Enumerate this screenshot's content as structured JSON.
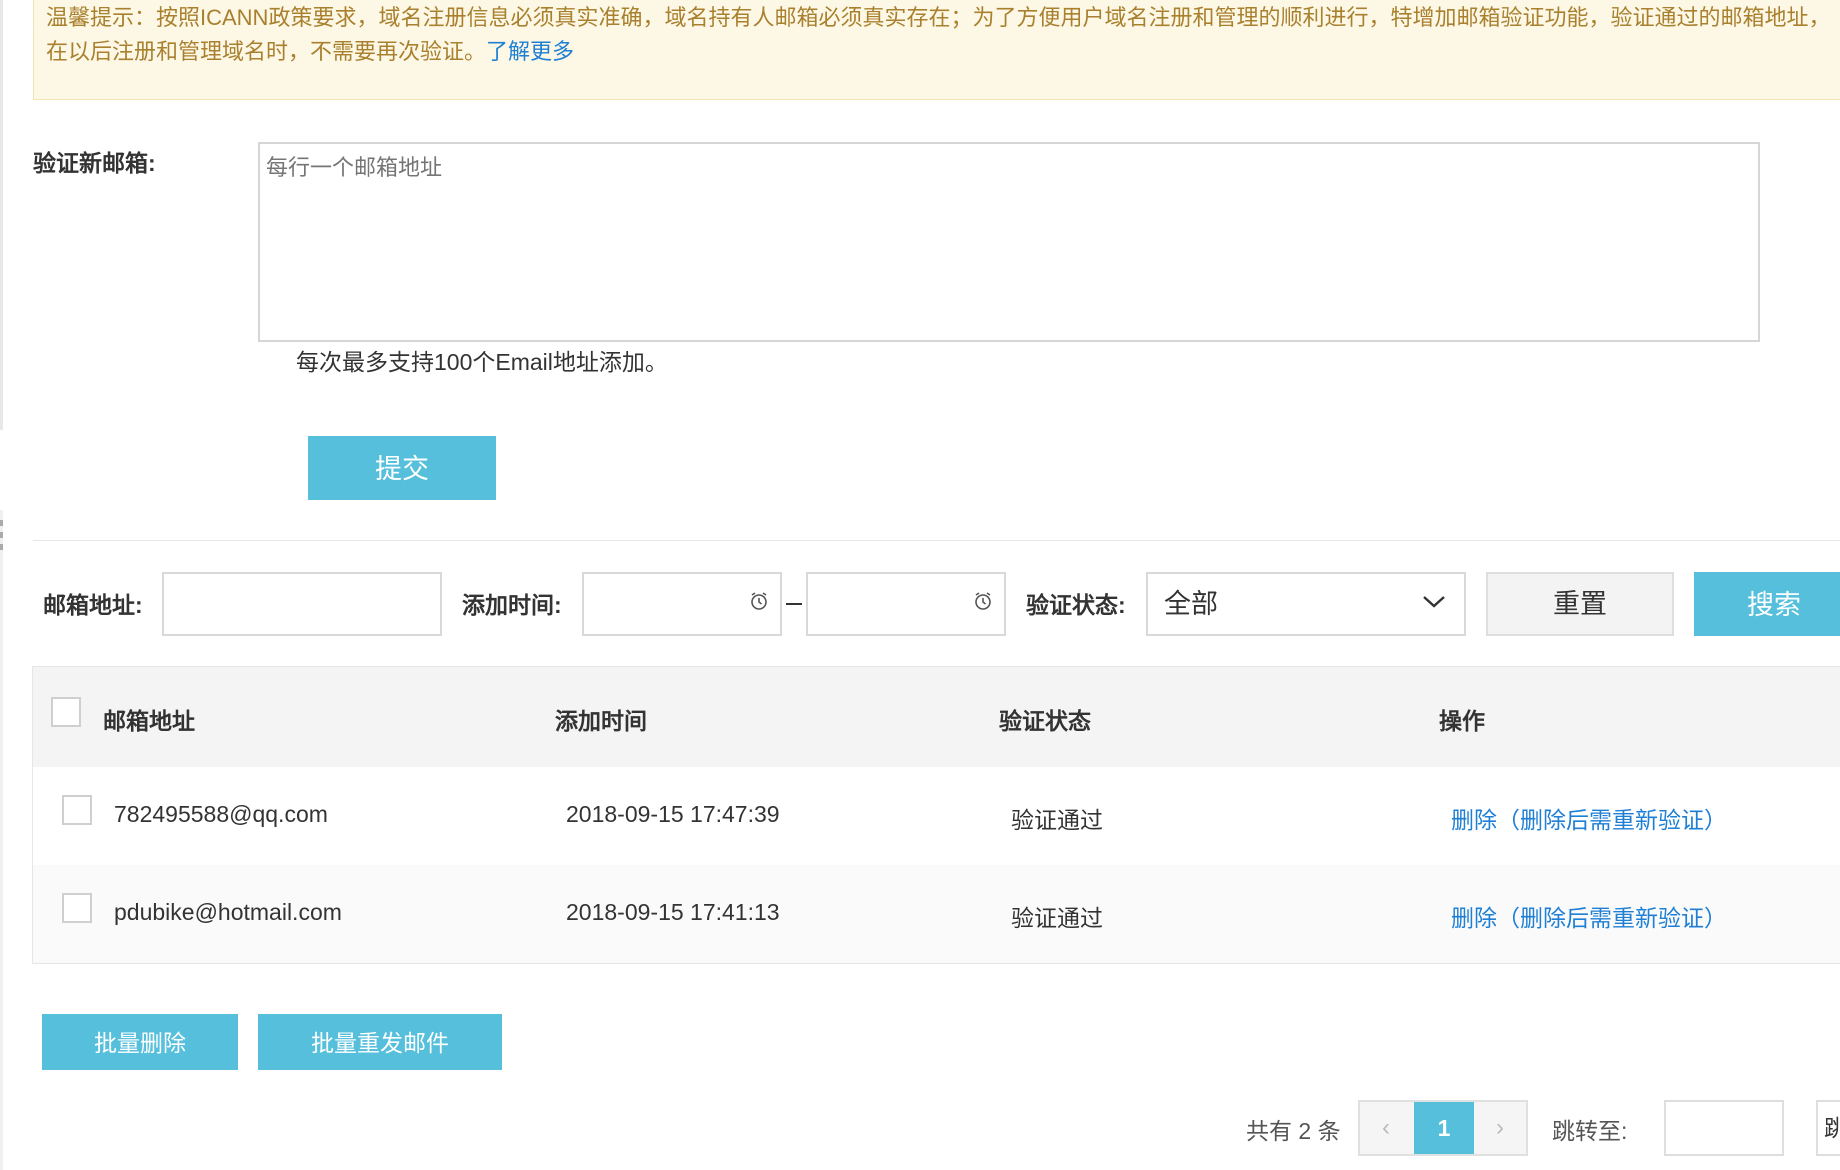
{
  "notice": {
    "text": "温馨提示：按照ICANN政策要求，域名注册信息必须真实准确，域名持有人邮箱必须真实存在；为了方便用户域名注册和管理的顺利进行，特增加邮箱验证功能，验证通过的邮箱地址，在以后注册和管理域名时，不需要再次验证。",
    "link": "了解更多"
  },
  "verify_form": {
    "label": "验证新邮箱:",
    "placeholder": "每行一个邮箱地址",
    "hint": "每次最多支持100个Email地址添加。",
    "submit_label": "提交"
  },
  "filters": {
    "email_label": "邮箱地址:",
    "email_value": "",
    "time_label": "添加时间:",
    "time_separator": "—",
    "status_label": "验证状态:",
    "status_value": "全部",
    "reset_label": "重置",
    "search_label": "搜索"
  },
  "table": {
    "headers": [
      "邮箱地址",
      "添加时间",
      "验证状态",
      "操作"
    ],
    "rows": [
      {
        "email": "782495588@qq.com",
        "time": "2018-09-15 17:47:39",
        "status": "验证通过",
        "action": "删除（删除后需重新验证）"
      },
      {
        "email": "pdubike@hotmail.com",
        "time": "2018-09-15 17:41:13",
        "status": "验证通过",
        "action": "删除（删除后需重新验证）"
      }
    ]
  },
  "batch": {
    "delete_label": "批量删除",
    "resend_label": "批量重发邮件"
  },
  "pagination": {
    "total": "共有 2 条",
    "prev": "‹",
    "current": "1",
    "next": "›",
    "jump_label": "跳转至:",
    "jump_button": "跳"
  },
  "colors": {
    "accent": "#56bfdb",
    "link": "#1e7fd4",
    "notice_bg": "#fdf8e6",
    "notice_text": "#a9802e"
  }
}
